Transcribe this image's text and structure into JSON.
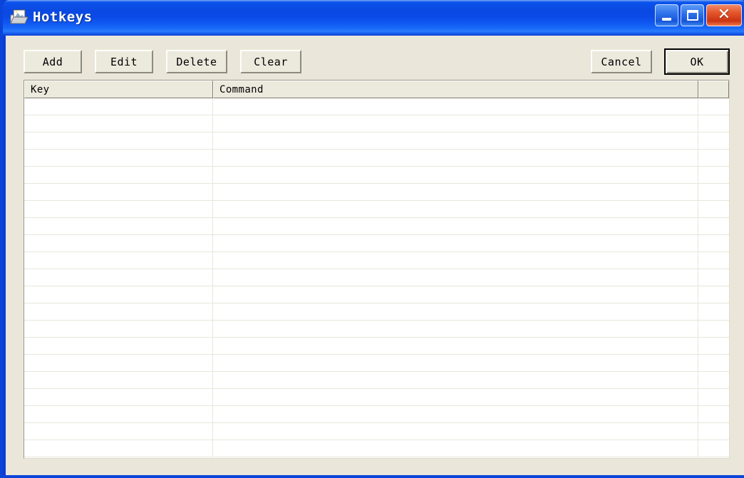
{
  "window": {
    "title": "Hotkeys",
    "icon": "open-folder-image-icon",
    "controls": {
      "minimize_label": "_",
      "maximize_label": "□",
      "close_label": "✕"
    },
    "colors": {
      "titlebar_blue": "#0a49e2",
      "frame_blue": "#0b44d8",
      "dialog_background": "#eae7da",
      "button_face": "#ece9dd",
      "close_button_red": "#cc3413",
      "list_background": "#ffffff",
      "grid_line": "#e8e6d9",
      "text": "#000000"
    }
  },
  "toolbar": {
    "add_label": "Add",
    "edit_label": "Edit",
    "delete_label": "Delete",
    "clear_label": "Clear",
    "cancel_label": "Cancel",
    "ok_label": "OK"
  },
  "list": {
    "columns": [
      {
        "key": "key",
        "label": "Key"
      },
      {
        "key": "command",
        "label": "Command"
      },
      {
        "key": "extra",
        "label": ""
      }
    ],
    "rows": [],
    "empty_row_count": 21
  }
}
